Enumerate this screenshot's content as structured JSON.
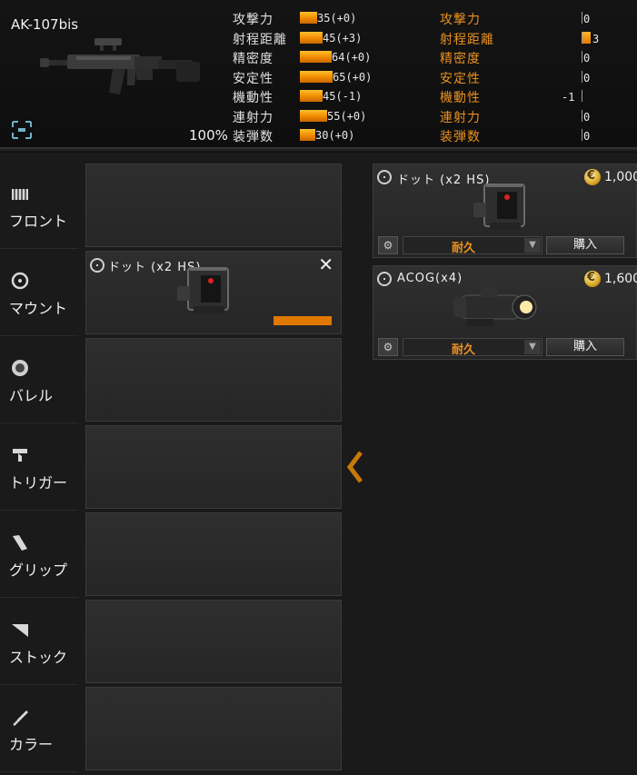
{
  "weapon": {
    "name": "AK-107bis",
    "durability": "100%"
  },
  "stats": [
    {
      "label": "攻撃力",
      "value": "35(+0)",
      "bar": 35
    },
    {
      "label": "射程距離",
      "value": "45(+3)",
      "bar": 45
    },
    {
      "label": "精密度",
      "value": "64(+0)",
      "bar": 64
    },
    {
      "label": "安定性",
      "value": "65(+0)",
      "bar": 65
    },
    {
      "label": "機動性",
      "value": "45(-1)",
      "bar": 45
    },
    {
      "label": "連射力",
      "value": "55(+0)",
      "bar": 55
    },
    {
      "label": "装弾数",
      "value": "30(+0)",
      "bar": 30
    }
  ],
  "diffs": [
    {
      "label": "攻撃力",
      "value": "0",
      "bar": 0
    },
    {
      "label": "射程距離",
      "value": "3",
      "bar": 3
    },
    {
      "label": "精密度",
      "value": "0",
      "bar": 0
    },
    {
      "label": "安定性",
      "value": "0",
      "bar": 0
    },
    {
      "label": "機動性",
      "value": "-1",
      "bar": -1
    },
    {
      "label": "連射力",
      "value": "0",
      "bar": 0
    },
    {
      "label": "装弾数",
      "value": "0",
      "bar": 0
    }
  ],
  "categories": [
    {
      "label": "フロント",
      "icon": "front-icon"
    },
    {
      "label": "マウント",
      "icon": "mount-icon"
    },
    {
      "label": "バレル",
      "icon": "barrel-icon"
    },
    {
      "label": "トリガー",
      "icon": "trigger-icon"
    },
    {
      "label": "グリップ",
      "icon": "grip-icon"
    },
    {
      "label": "ストック",
      "icon": "stock-icon"
    },
    {
      "label": "カラー",
      "icon": "color-icon"
    }
  ],
  "equipped": {
    "mount": {
      "name": "ドット (x2 HS)",
      "durability": 1.0
    }
  },
  "shop": [
    {
      "name": "ドット (x2 HS)",
      "price": "1,000",
      "durability_label": "耐久",
      "buy_label": "購入"
    },
    {
      "name": "ACOG(x4)",
      "price": "1,600",
      "durability_label": "耐久",
      "buy_label": "購入"
    }
  ],
  "colors": {
    "accent": "#f08a00",
    "accent_text": "#e89020"
  }
}
